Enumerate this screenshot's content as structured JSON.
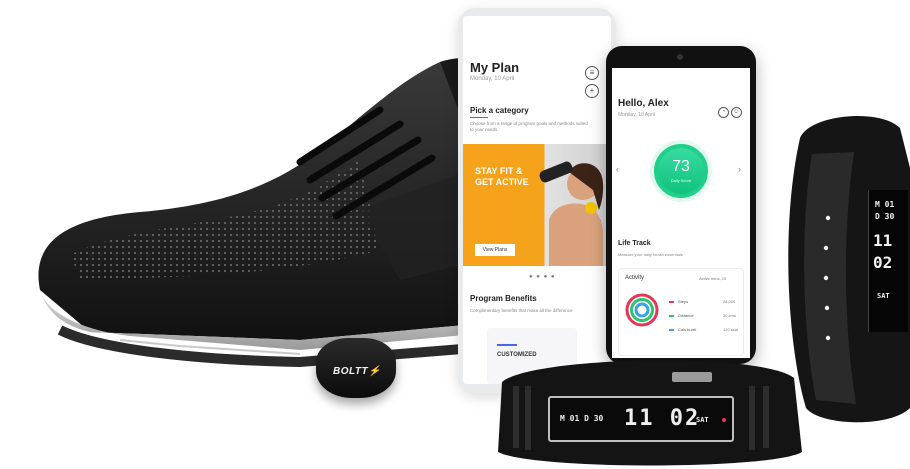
{
  "pod": {
    "brand": "BOLTT"
  },
  "phone_plan": {
    "title": "My Plan",
    "date": "Monday, 10 April",
    "section_category": "Pick a category",
    "category_desc": "Choose from a range of program goals and methods suited to your needs.",
    "banner_text": "STAY FIT & GET ACTIVE",
    "banner_button": "View Plans",
    "section_benefits": "Program Benefits",
    "benefits_desc": "Complimentary benefits that make all the difference",
    "card_label": "CUSTOMIZED"
  },
  "phone_home": {
    "greeting": "Hello, Alex",
    "date": "Monday, 10 April",
    "score_value": "73",
    "score_label": "Daily Score",
    "life_track": "Life Track",
    "life_desc": "Measure your daily health essentials",
    "activity_title": "Activity",
    "activity_right": "Active mins, 20",
    "activity_rows": [
      {
        "label": "Steps",
        "value": "28,000",
        "color": "#e8365a"
      },
      {
        "label": "Distance",
        "value": "30 kms",
        "color": "#2bc46d"
      },
      {
        "label": "Cals burnt",
        "value": "120 kcal",
        "color": "#3aa0e8"
      }
    ]
  },
  "band_right": {
    "month": "M 01",
    "day": "D 30",
    "time": "11 02",
    "weekday": "SAT"
  },
  "band_front": {
    "date": "M 01 D 30",
    "time": "11 02",
    "weekday": "SAT"
  },
  "colors": {
    "banner": "#f7a21b",
    "score": "#20d08a",
    "accent": "#e8365a"
  }
}
